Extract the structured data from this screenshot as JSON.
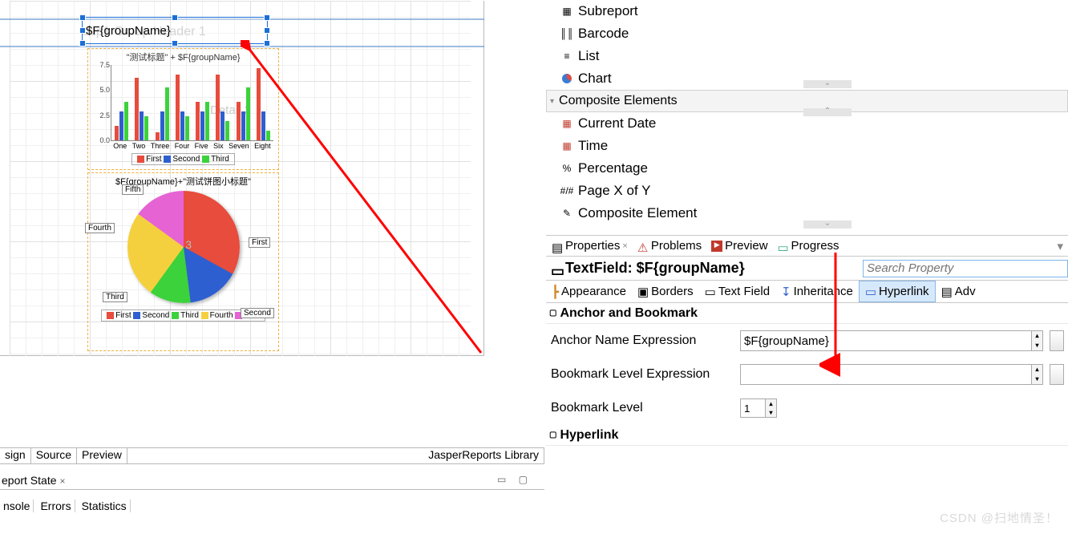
{
  "designer": {
    "selected_field_text": "$F{groupName}",
    "ghost_band_label": "oup1 Group Header 1",
    "detail_ghost": "Detail 2",
    "bar_title": "\"测试标题\" + $F{groupName}",
    "pie_title": "$F{groupName}+\"测试饼图小标题\"",
    "pie_center_label": "3"
  },
  "chart_data": [
    {
      "type": "bar",
      "title": "\"测试标题\" + $F{groupName}",
      "ylim": [
        0,
        7.5
      ],
      "yticks": [
        "7.5",
        "5.0",
        "2.5",
        "0.0"
      ],
      "categories": [
        "One",
        "Two",
        "Three",
        "Four",
        "Five",
        "Six",
        "Seven",
        "Eight"
      ],
      "series": [
        {
          "name": "First",
          "color": "#e74c3c",
          "values": [
            1.5,
            6.5,
            0.8,
            6.8,
            4.0,
            6.8,
            4.0,
            7.5
          ]
        },
        {
          "name": "Second",
          "color": "#2e5fd0",
          "values": [
            3.0,
            3.0,
            3.0,
            3.0,
            3.0,
            3.0,
            3.0,
            3.0
          ]
        },
        {
          "name": "Third",
          "color": "#3cd23c",
          "values": [
            4.0,
            2.5,
            5.5,
            2.5,
            4.0,
            2.0,
            5.5,
            1.0
          ]
        }
      ]
    },
    {
      "type": "pie",
      "title": "$F{groupName}+\"测试饼图小标题\"",
      "slices": [
        {
          "name": "First",
          "color": "#e74c3c",
          "value": 33
        },
        {
          "name": "Second",
          "color": "#2e5fd0",
          "value": 15
        },
        {
          "name": "Third",
          "color": "#3cd23c",
          "value": 12
        },
        {
          "name": "Fourth",
          "color": "#f4d03f",
          "value": 25
        },
        {
          "name": "Fifth",
          "color": "#e663d4",
          "value": 15
        }
      ]
    }
  ],
  "bottom_tabs": {
    "design": "sign",
    "source": "Source",
    "preview": "Preview",
    "library": "JasperReports Library"
  },
  "report_state": {
    "title": "eport State",
    "t1": "nsole",
    "t2": "Errors",
    "t3": "Statistics"
  },
  "palette": {
    "subreport": "Subreport",
    "barcode": "Barcode",
    "list": "List",
    "chart": "Chart",
    "composite_section": "Composite Elements",
    "current_date": "Current Date",
    "time": "Time",
    "percentage": "Percentage",
    "pagexy": "Page X of Y",
    "composite_elem": "Composite Element"
  },
  "views": {
    "properties": "Properties",
    "problems": "Problems",
    "preview": "Preview",
    "progress": "Progress"
  },
  "props_title": "TextField: $F{groupName}",
  "search_placeholder": "Search Property",
  "prop_tabs": {
    "appearance": "Appearance",
    "borders": "Borders",
    "textfield": "Text Field",
    "inheritance": "Inheritance",
    "hyperlink": "Hyperlink",
    "advanced": "Adv"
  },
  "section_anchor": "Anchor and Bookmark",
  "form": {
    "anchor_label": "Anchor Name Expression",
    "anchor_value": "$F{groupName}",
    "bookmark_expr_label": "Bookmark Level Expression",
    "bookmark_expr_value": "",
    "bookmark_level_label": "Bookmark Level",
    "bookmark_level_value": "1"
  },
  "section_hyperlink": "Hyperlink",
  "watermark": "CSDN @扫地情圣！"
}
